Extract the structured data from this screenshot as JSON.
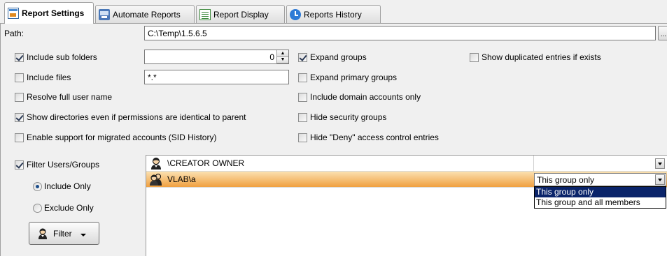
{
  "tabs": [
    {
      "label": "Report Settings",
      "icon": "report-settings-icon",
      "active": true
    },
    {
      "label": "Automate Reports",
      "icon": "automate-reports-icon",
      "active": false
    },
    {
      "label": "Report Display",
      "icon": "report-display-icon",
      "active": false
    },
    {
      "label": "Reports History",
      "icon": "reports-history-icon",
      "active": false
    }
  ],
  "path": {
    "label": "Path:",
    "value": "C:\\Temp\\1.5.6.5",
    "browse_label": "..."
  },
  "options": {
    "include_sub_folders": {
      "label": "Include sub folders",
      "checked": true,
      "depth_value": "0"
    },
    "include_files": {
      "label": "Include files",
      "checked": false,
      "pattern_value": "*.*"
    },
    "resolve_full_user_name": {
      "label": "Resolve full user name",
      "checked": false
    },
    "show_directories": {
      "label": "Show directories even if permissions are identical to parent",
      "checked": true
    },
    "enable_sid_history": {
      "label": "Enable support for migrated accounts (SID History)",
      "checked": false
    },
    "expand_groups": {
      "label": "Expand  groups",
      "checked": true
    },
    "expand_primary_groups": {
      "label": "Expand primary groups",
      "checked": false
    },
    "include_domain_accounts_only": {
      "label": "Include domain accounts only",
      "checked": false
    },
    "hide_security_groups": {
      "label": "Hide security groups",
      "checked": false
    },
    "hide_deny_entries": {
      "label": "Hide \"Deny\" access control entries",
      "checked": false
    },
    "show_duplicated_entries": {
      "label": "Show duplicated entries if exists",
      "checked": false
    }
  },
  "filter": {
    "enable_label": "Filter Users/Groups",
    "enabled": true,
    "include_only_label": "Include Only",
    "exclude_only_label": "Exclude Only",
    "mode": "include",
    "button_label": "Filter"
  },
  "filter_entries": [
    {
      "name": "\\CREATOR OWNER",
      "scope": "",
      "selected": false
    },
    {
      "name": "VLAB\\a",
      "scope": "This group only",
      "selected": true
    }
  ],
  "scope_options": [
    "This group only",
    "This group and all members"
  ],
  "scope_highlighted": "This group only",
  "colors": {
    "selection_orange": "#f0a040",
    "dropdown_highlight": "#0a246a"
  }
}
